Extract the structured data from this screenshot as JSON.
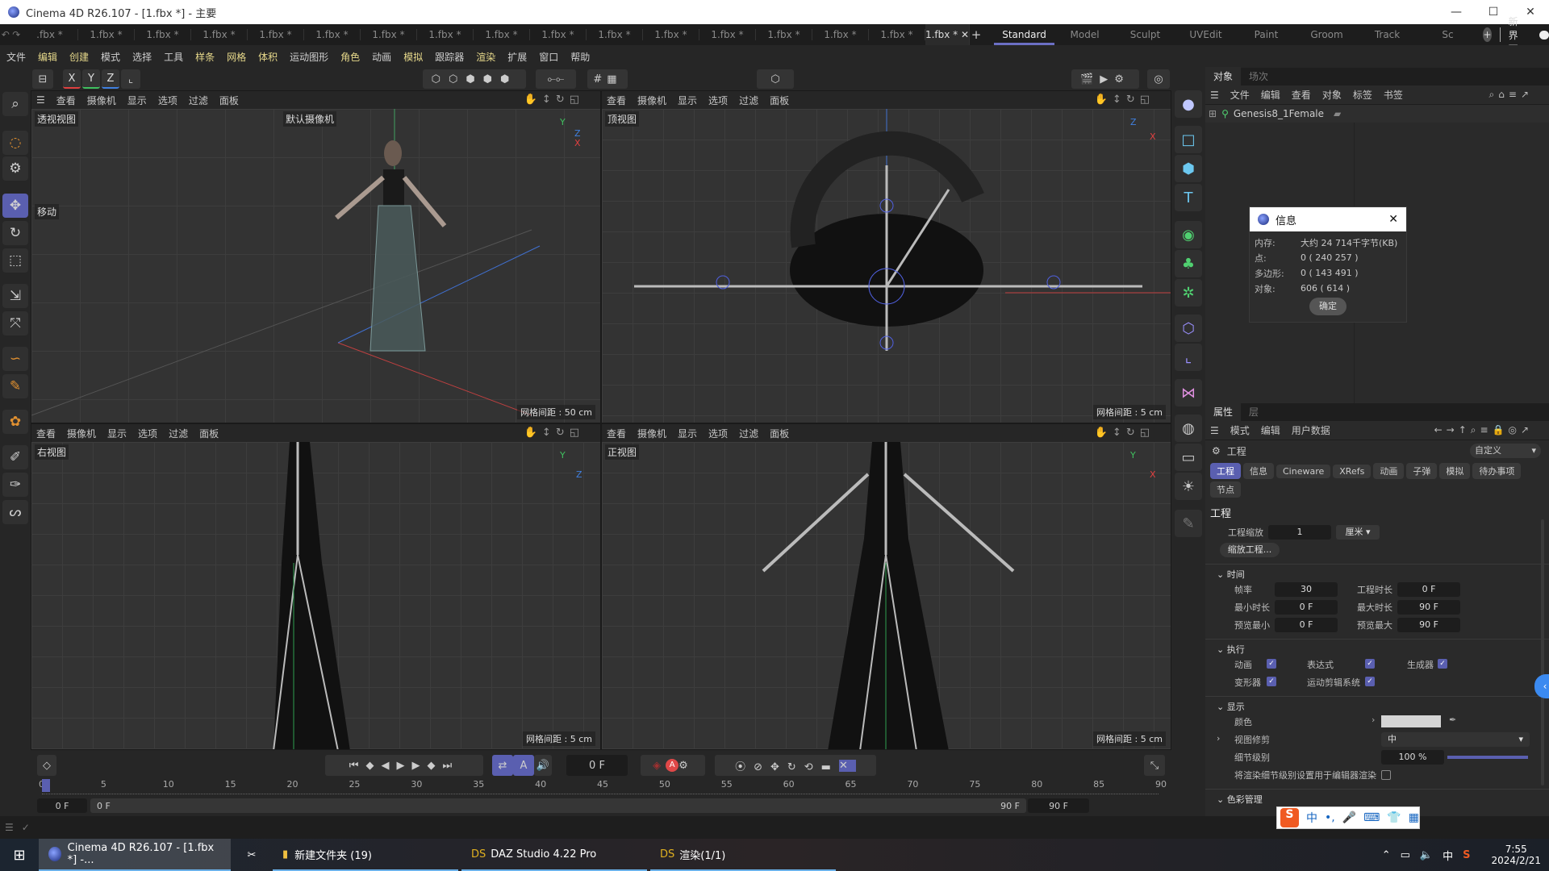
{
  "window": {
    "title": "Cinema 4D R26.107 - [1.fbx *] - 主要",
    "controls": [
      "—",
      "☐",
      "✕"
    ]
  },
  "file_tabs": [
    ".fbx *",
    "1.fbx *",
    "1.fbx *",
    "1.fbx *",
    "1.fbx *",
    "1.fbx *",
    "1.fbx *",
    "1.fbx *",
    "1.fbx *",
    "1.fbx *",
    "1.fbx *",
    "1.fbx *",
    "1.fbx *",
    "1.fbx *",
    "1.fbx *",
    "1.fbx *"
  ],
  "active_file_tab": "1.fbx *",
  "layout_tabs": [
    "Standard",
    "Model",
    "Sculpt",
    "UVEdit",
    "Paint",
    "Groom",
    "Track",
    "Sc"
  ],
  "active_layout": "Standard",
  "new_ui_label": "新界面",
  "menu": [
    "文件",
    "编辑",
    "创建",
    "模式",
    "选择",
    "工具",
    "样条",
    "网格",
    "体积",
    "运动图形",
    "角色",
    "动画",
    "模拟",
    "跟踪器",
    "渲染",
    "扩展",
    "窗口",
    "帮助"
  ],
  "toolbar_axes": [
    "X",
    "Y",
    "Z"
  ],
  "viewport_menu": [
    "查看",
    "摄像机",
    "显示",
    "选项",
    "过滤",
    "面板"
  ],
  "viewports": [
    {
      "label": "透视视图",
      "camera": "默认摄像机",
      "tool_hint": "移动",
      "grid": "网格间距 : 50 cm"
    },
    {
      "label": "顶视图",
      "grid": "网格间距 : 5 cm"
    },
    {
      "label": "右视图",
      "grid": "网格间距 : 5 cm"
    },
    {
      "label": "正视图",
      "grid": "网格间距 : 5 cm"
    }
  ],
  "object_panel": {
    "tabs": [
      "对象",
      "场次"
    ],
    "menu": [
      "文件",
      "编辑",
      "查看",
      "对象",
      "标签",
      "书签"
    ],
    "objects": [
      {
        "name": "Genesis8_1Female"
      }
    ]
  },
  "info_dialog": {
    "title": "信息",
    "rows": [
      {
        "k": "内存:",
        "v": "大约 24 714千字节(KB)"
      },
      {
        "k": "点:",
        "v": "0 ( 240 257 )"
      },
      {
        "k": "多边形:",
        "v": "0 ( 143 491 )"
      },
      {
        "k": "对象:",
        "v": "606 ( 614 )"
      }
    ],
    "ok": "确定"
  },
  "attributes": {
    "tabs": [
      "属性",
      "层"
    ],
    "menu": [
      "模式",
      "编辑",
      "用户数据"
    ],
    "object": "工程",
    "preset": "自定义",
    "chips": [
      "工程",
      "信息",
      "Cineware",
      "XRefs",
      "动画",
      "子弹",
      "模拟",
      "待办事项",
      "节点"
    ],
    "section_title": "工程",
    "project_scale_label": "工程缩放",
    "project_scale": "1",
    "unit": "厘米",
    "scale_btn": "缩放工程...",
    "time": {
      "title": "时间",
      "fps_label": "帧率",
      "fps": "30",
      "duration_label": "工程时长",
      "duration": "0 F",
      "min_label": "最小时长",
      "min": "0 F",
      "max_label": "最大时长",
      "max": "90 F",
      "pmin_label": "预览最小",
      "pmin": "0 F",
      "pmax_label": "预览最大",
      "pmax": "90 F"
    },
    "exec": {
      "title": "执行",
      "items": [
        {
          "label": "动画",
          "checked": true
        },
        {
          "label": "表达式",
          "checked": true
        },
        {
          "label": "生成器",
          "checked": true
        },
        {
          "label": "变形器",
          "checked": true
        },
        {
          "label": "运动剪辑系统",
          "checked": true
        }
      ]
    },
    "display": {
      "title": "显示",
      "color_label": "颜色",
      "color": "#d4d4d4",
      "clip_label": "视图修剪",
      "clip": "中",
      "lod_label": "细节级别",
      "lod": "100 %",
      "lod_value": 100,
      "render_lod_label": "将渲染细节级别设置用于编辑器渲染",
      "render_lod": false
    },
    "next_section": "色彩管理"
  },
  "timeline": {
    "current": "0 F",
    "ticks": [
      0,
      5,
      10,
      15,
      20,
      25,
      30,
      35,
      40,
      45,
      50,
      55,
      60,
      65,
      70,
      75,
      80,
      85,
      90
    ],
    "start": "0 F",
    "range_start": "0 F",
    "range_end": "90 F",
    "end": "90 F"
  },
  "ime": {
    "lang": "中",
    "punct": "•,"
  },
  "taskbar": {
    "items": [
      "Cinema 4D R26.107 - [1.fbx *] -...",
      "新建文件夹 (19)",
      "DAZ Studio 4.22 Pro",
      "渲染(1/1)"
    ],
    "tray_lang": "中",
    "time": "7:55",
    "date": "2024/2/21"
  },
  "colors": {
    "accent": "#5a5fb0",
    "background": "#262626",
    "axis_x": "#e04040",
    "axis_y": "#40c060",
    "axis_z": "#4080e0"
  }
}
